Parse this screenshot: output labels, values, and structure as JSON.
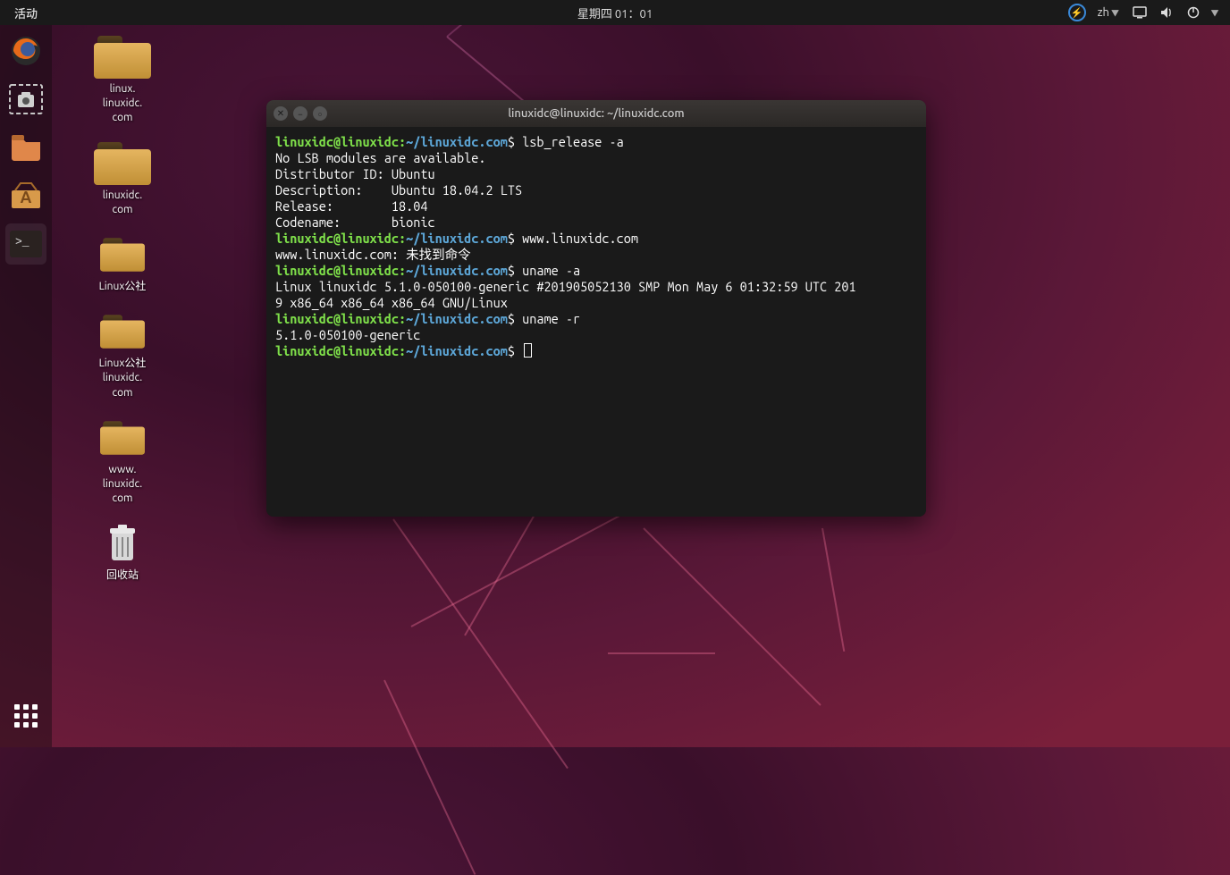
{
  "topbar": {
    "activities": "活动",
    "datetime": "星期四 01：01",
    "lang": "zh"
  },
  "dock": {
    "items": [
      "firefox",
      "screenshot",
      "files",
      "software",
      "terminal"
    ]
  },
  "desktop": {
    "icons": [
      {
        "label": "linux.\nlinuxidc.\ncom"
      },
      {
        "label": "linuxidc.\ncom"
      },
      {
        "label": "Linux公社"
      },
      {
        "label": "Linux公社\nlinuxidc.\ncom"
      },
      {
        "label": "www.\nlinuxidc.\ncom"
      },
      {
        "label": "回收站"
      }
    ]
  },
  "terminal": {
    "title": "linuxidc@linuxidc: ~/linuxidc.com",
    "prompt_user": "linuxidc@linuxidc",
    "prompt_path": "~/linuxidc.com",
    "lines": {
      "cmd1": " lsb_release -a",
      "out1": "No LSB modules are available.",
      "out2": "Distributor ID: Ubuntu",
      "out3": "Description:    Ubuntu 18.04.2 LTS",
      "out4": "Release:        18.04",
      "out5": "Codename:       bionic",
      "cmd2": " www.linuxidc.com",
      "out6": "www.linuxidc.com: 未找到命令",
      "cmd3": " uname -a",
      "out7": "Linux linuxidc 5.1.0-050100-generic #201905052130 SMP Mon May 6 01:32:59 UTC 201\n9 x86_64 x86_64 x86_64 GNU/Linux",
      "cmd4": " uname -r",
      "out8": "5.1.0-050100-generic"
    }
  }
}
